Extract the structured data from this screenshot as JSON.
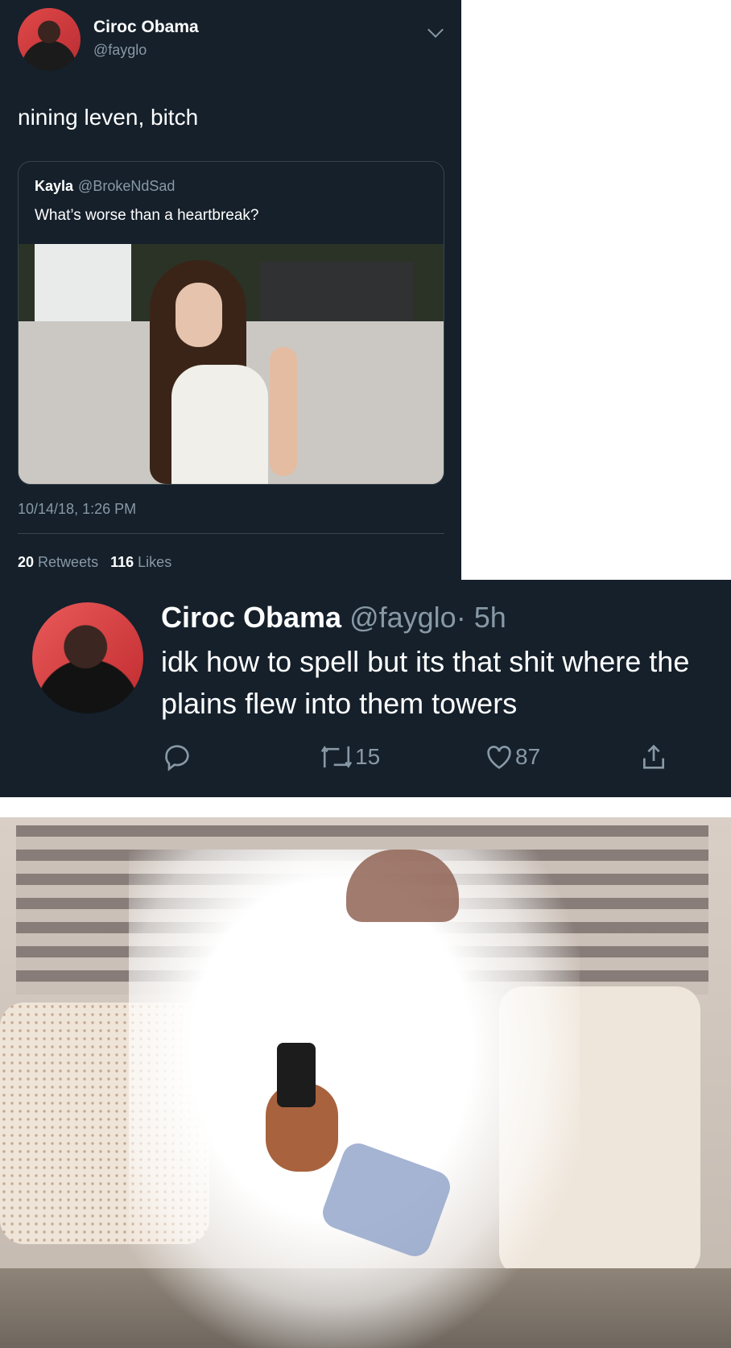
{
  "tweet1": {
    "name": "Ciroc Obama",
    "handle": "@fayglo",
    "text": "nining leven, bitch",
    "quote": {
      "name": "Kayla",
      "handle": "@BrokeNdSad",
      "text": "What’s worse than a heartbreak?"
    },
    "timestamp": "10/14/18, 1:26 PM",
    "retweets_count": "20",
    "retweets_label": "Retweets",
    "likes_count": "116",
    "likes_label": "Likes"
  },
  "tweet2": {
    "name": "Ciroc Obama",
    "handle": "@fayglo",
    "age": "· 5h",
    "text": "idk how to spell but its that shit where the plains flew into them towers",
    "retweet_count": "15",
    "like_count": "87"
  },
  "icons": [
    "chevron-down-icon",
    "reply-icon",
    "retweet-icon",
    "heart-icon",
    "share-icon"
  ],
  "colors": {
    "background": "#15202b",
    "secondary_text": "#8899a6",
    "divider": "#38444d"
  }
}
